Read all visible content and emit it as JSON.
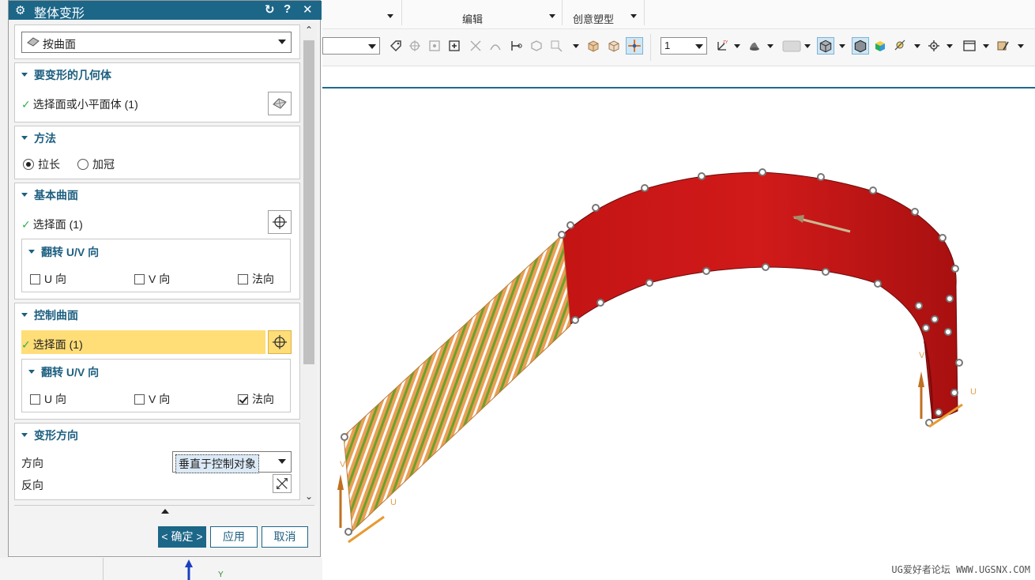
{
  "dialog": {
    "title": "整体变形",
    "type_dropdown": "按曲面",
    "confirm_label": "< 确定 >",
    "apply_label": "应用",
    "cancel_label": "取消"
  },
  "sections": {
    "geometry": {
      "title": "要变形的几何体",
      "select_label": "选择面或小平面体 (1)"
    },
    "method": {
      "title": "方法",
      "options": [
        "拉长",
        "加冠"
      ],
      "selected": "拉长"
    },
    "base_surface": {
      "title": "基本曲面",
      "select_label": "选择面 (1)",
      "flip_title": "翻转 U/V 向",
      "u": "U 向",
      "v": "V 向",
      "normal": "法向"
    },
    "control_surface": {
      "title": "控制曲面",
      "select_label": "选择面 (1)",
      "flip_title": "翻转 U/V 向",
      "u": "U 向",
      "v": "V 向",
      "normal": "法向",
      "normal_checked": true
    },
    "direction": {
      "title": "变形方向",
      "direction_label": "方向",
      "direction_value": "垂直于控制对象",
      "reverse_label": "反向"
    }
  },
  "ribbon": {
    "group_edit": "编辑",
    "group_creative": "创意塑型"
  },
  "toolbar": {
    "layer_value": "1"
  },
  "viewport": {
    "label_u1": "U",
    "label_v1": "V",
    "label_u2": "U",
    "label_v2": "V",
    "label_y": "Y"
  },
  "watermark": "UG爱好者论坛 WWW.UGSNX.COM"
}
